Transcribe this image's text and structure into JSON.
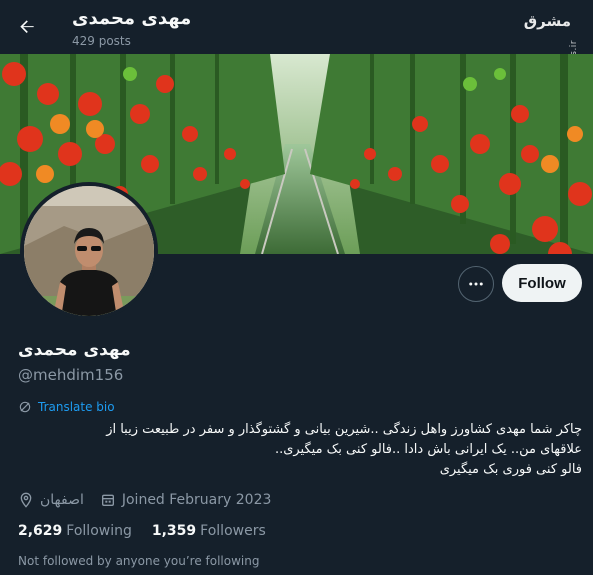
{
  "header": {
    "name": "مهدی محمدی",
    "posts": "429 posts",
    "back_icon": "arrow-left-icon"
  },
  "watermark": {
    "logo_text": "مشرق",
    "side_text": "mashreghnews.ir"
  },
  "profile": {
    "name": "مهدی محمدی",
    "handle": "@mehdim156",
    "translate_label": "Translate bio",
    "bio_lines": [
      "چاکر شما مهدی کشاورز واهل زندگی ..شیرین بیانی و گشتوگذار و سفر در طبیعت زیبا از",
      "علاقهای من.. یک ایرانی باش دادا ..فالو کنی بک میگیری..",
      "فالو کنی فوری بک میگیری"
    ],
    "location": "اصفهان",
    "joined": "Joined February 2023",
    "following_count": "2,629",
    "following_label": "Following",
    "followers_count": "1,359",
    "followers_label": "Followers",
    "not_followed": "Not followed by anyone you’re following"
  },
  "actions": {
    "follow_label": "Follow",
    "more_icon": "more-horizontal-icon"
  },
  "colors": {
    "background": "#15202b",
    "accent": "#1d9bf0",
    "secondary_text": "#8b98a5",
    "button_bg": "#eff3f4"
  }
}
